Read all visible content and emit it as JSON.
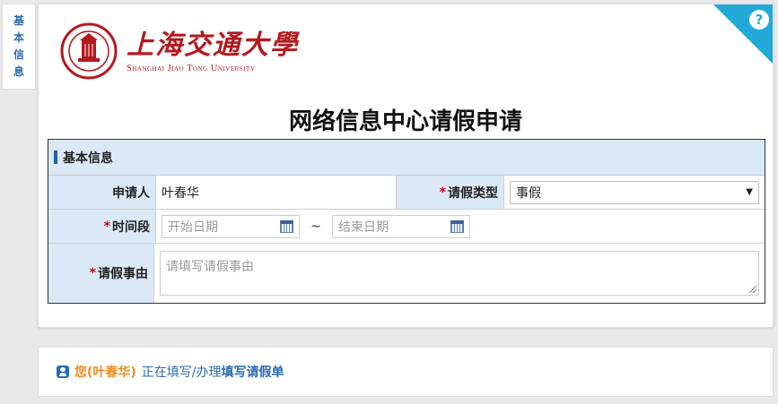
{
  "side_tab": {
    "label_chars": [
      "基",
      "本",
      "信",
      "息"
    ]
  },
  "help": {
    "glyph": "?"
  },
  "brand": {
    "name_cn": "上海交通大學",
    "name_en": "Shanghai Jiao Tong University",
    "color": "#b3191e"
  },
  "page": {
    "title": "网络信息中心请假申请"
  },
  "form": {
    "section_title": "基本信息",
    "applicant_label": "申请人",
    "applicant_value": "叶春华",
    "leave_type_label": "请假类型",
    "leave_type_value": "事假",
    "period_label": "时间段",
    "start_placeholder": "开始日期",
    "range_sep": "~",
    "end_placeholder": "结束日期",
    "reason_label": "请假事由",
    "reason_placeholder": "请填写请假事由",
    "required_mark": "*"
  },
  "footer": {
    "you": "您(叶春华)",
    "doing": "正在填写/办理",
    "task": "填写请假单"
  },
  "colors": {
    "accent": "#2a6bb0",
    "header_bg": "#dbe9f6",
    "required": "#d0021b",
    "corner": "#22a9d8"
  }
}
